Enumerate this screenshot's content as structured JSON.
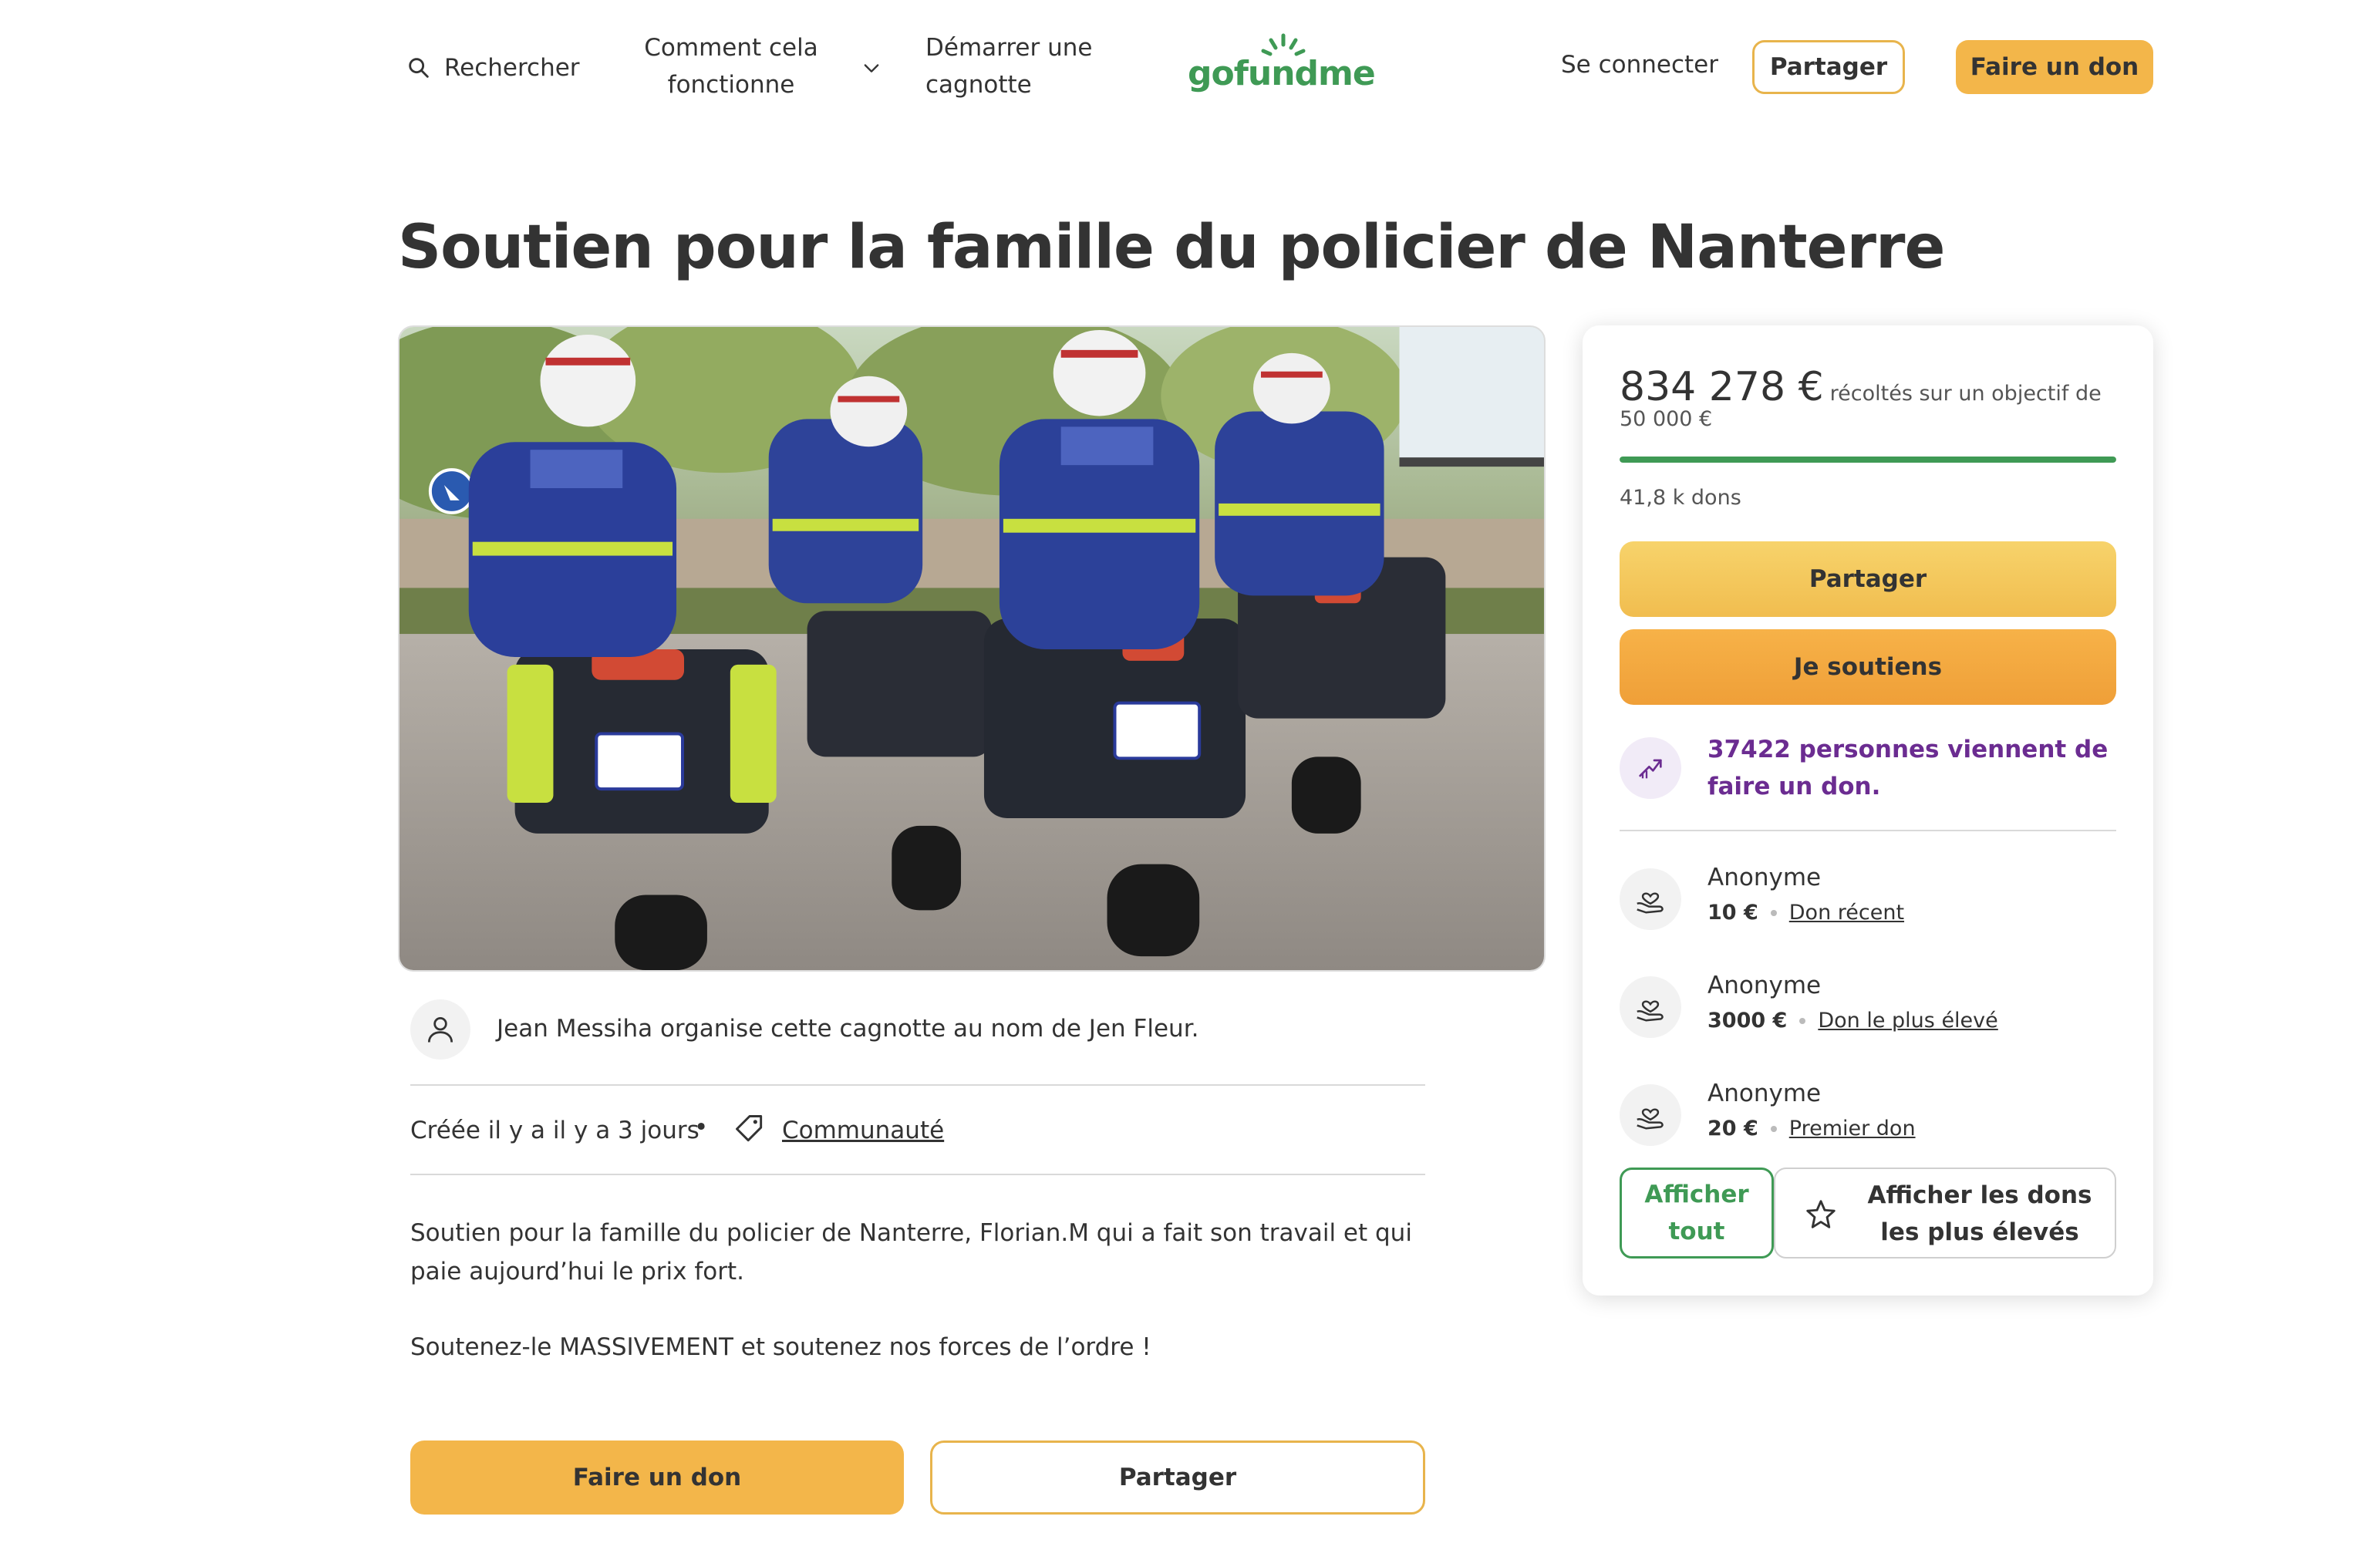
{
  "header": {
    "search_label": "Rechercher",
    "how_it_works_label": "Comment cela fonctionne",
    "start_label": "Démarrer une cagnotte",
    "logo_text": "gofundme",
    "login_label": "Se connecter",
    "share_label": "Partager",
    "donate_label": "Faire un don"
  },
  "campaign": {
    "title": "Soutien pour la famille du policier de Nanterre",
    "image_icon": "police-motorcycles-photo",
    "organizer_text": "Jean Messiha organise cette cagnotte au nom de Jen Fleur.",
    "created": "Créée il y a il y a 3 jours",
    "separator": "•",
    "category": "Communauté",
    "description": [
      "Soutien pour la famille du policier de Nanterre, Florian.M qui a fait son travail et qui paie aujourd’hui le prix fort.",
      "Soutenez-le MASSIVEMENT et soutenez nos forces de l’ordre !"
    ],
    "donate_label": "Faire un don",
    "share_label": "Partager"
  },
  "sidebar": {
    "raised_amount": "834 278 €",
    "raised_suffix": "récoltés sur un objectif de",
    "goal": "50 000 €",
    "progress_fraction": 1.0,
    "donation_count": "41,8 k dons",
    "share_label": "Partager",
    "support_label": "Je soutiens",
    "recent_activity": "37422 personnes viennent de faire un don.",
    "donors": [
      {
        "name": "Anonyme",
        "amount": "10 €",
        "tag": "Don récent"
      },
      {
        "name": "Anonyme",
        "amount": "3000 €",
        "tag": "Don le plus élevé"
      },
      {
        "name": "Anonyme",
        "amount": "20 €",
        "tag": "Premier don"
      }
    ],
    "see_all_label": "Afficher tout",
    "see_top_label": "Afficher les dons les plus élevés"
  },
  "colors": {
    "brand_green": "#3f9a55",
    "button_yellow": "#f3b64a",
    "button_orange": "#ef9f38",
    "activity_purple": "#6b2c91"
  }
}
